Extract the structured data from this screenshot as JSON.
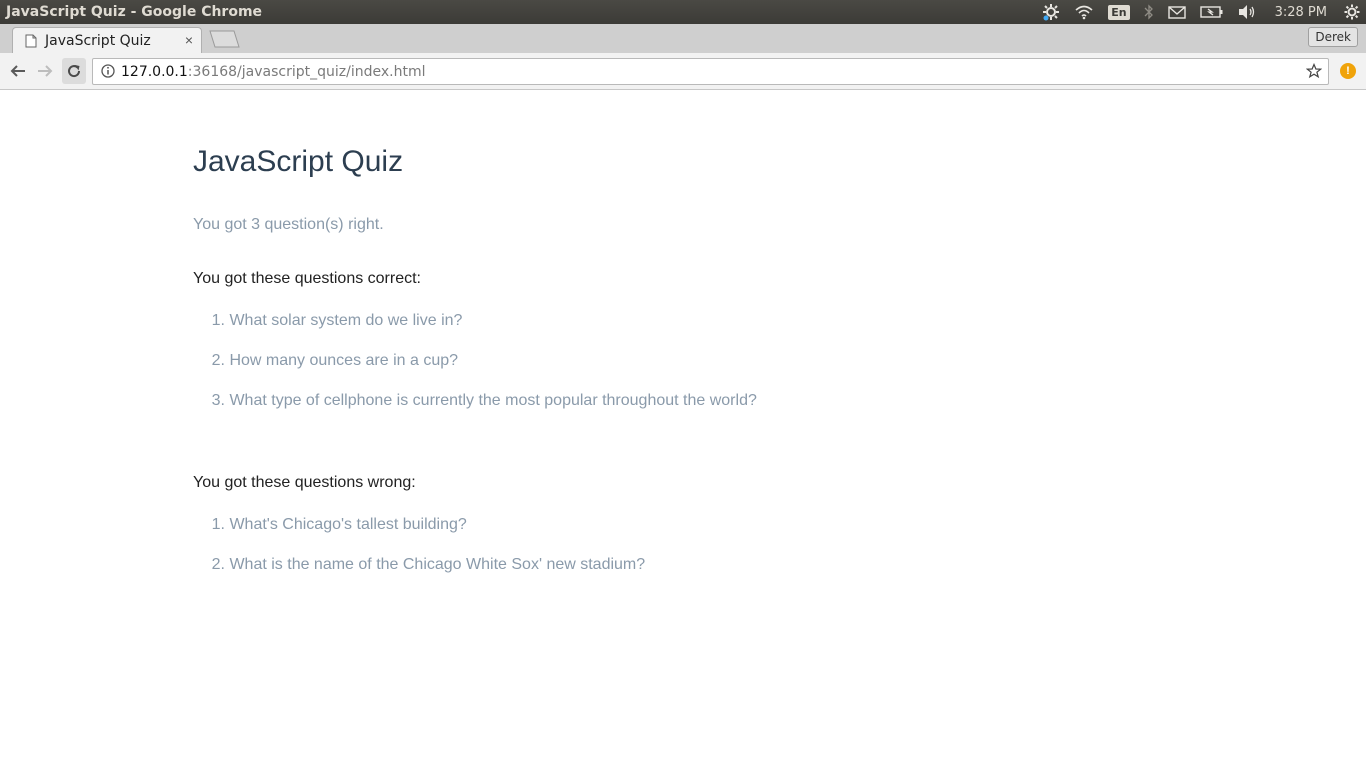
{
  "os_bar": {
    "window_title": "JavaScript Quiz - Google Chrome",
    "language": "En",
    "clock": "3:28 PM"
  },
  "browser": {
    "tab_title": "JavaScript Quiz",
    "tab_close": "×",
    "profile_name": "Derek",
    "url_host": "127.0.0.1",
    "url_rest": ":36168/javascript_quiz/index.html",
    "extension_badge": "!"
  },
  "page": {
    "title": "JavaScript Quiz",
    "score_text": "You got 3 question(s) right.",
    "correct_heading": "You got these questions correct:",
    "correct_questions": [
      {
        "num": "1.",
        "text": "What solar system do we live in?"
      },
      {
        "num": "2.",
        "text": "How many ounces are in a cup?"
      },
      {
        "num": "3.",
        "text": "What type of cellphone is currently the most popular throughout the world?"
      }
    ],
    "wrong_heading": "You got these questions wrong:",
    "wrong_questions": [
      {
        "num": "1.",
        "text": "What's Chicago's tallest building?"
      },
      {
        "num": "2.",
        "text": "What is the name of the Chicago White Sox' new stadium?"
      }
    ]
  },
  "colors": {
    "title": "#2c3e50",
    "muted_text": "#8a9aaa",
    "heading_text": "#222222",
    "os_bar": "#3c3b37",
    "extension_badge": "#f0a30a"
  }
}
